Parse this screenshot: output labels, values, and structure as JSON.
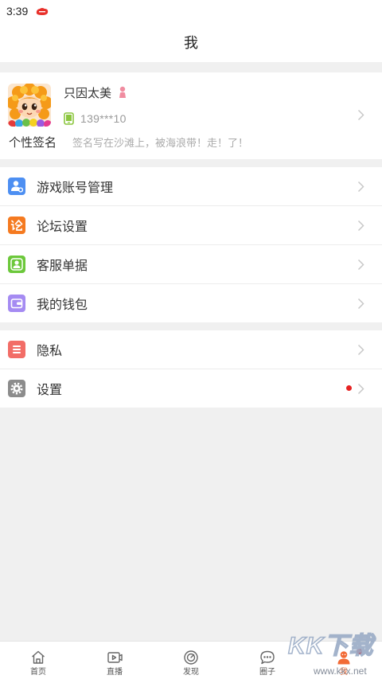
{
  "status_bar": {
    "time": "3:39",
    "notification_icon": "red-app-icon"
  },
  "header": {
    "title": "我"
  },
  "profile": {
    "avatar_icon": "sunflower-cartoon-avatar",
    "name": "只因太美",
    "gender_icon": "female-user-icon",
    "phone_icon": "phone-icon",
    "phone": "139***10",
    "signature_label": "个性签名",
    "signature": "签名写在沙滩上，被海浪带！走！了！"
  },
  "menu_groups": [
    {
      "items": [
        {
          "label": "游戏账号管理",
          "icon": "game-account-icon",
          "color": "#4d8ff2"
        },
        {
          "label": "论坛设置",
          "icon": "forum-settings-icon",
          "color": "#f57a20"
        },
        {
          "label": "客服单据",
          "icon": "customer-service-icon",
          "color": "#6cc83b"
        },
        {
          "label": "我的钱包",
          "icon": "wallet-icon",
          "color": "#a58bf2"
        }
      ]
    },
    {
      "items": [
        {
          "label": "隐私",
          "icon": "privacy-icon",
          "color": "#f26d67"
        },
        {
          "label": "设置",
          "icon": "settings-icon",
          "color": "#8c8c8c",
          "badge_dot": true
        }
      ]
    }
  ],
  "bottom_nav": {
    "active_color": "#f26a35",
    "items": [
      {
        "label": "首页",
        "icon": "home-icon"
      },
      {
        "label": "直播",
        "icon": "live-video-icon"
      },
      {
        "label": "发现",
        "icon": "discover-icon"
      },
      {
        "label": "圈子",
        "icon": "circle-chat-icon"
      },
      {
        "label": "我",
        "icon": "me-icon",
        "active": true,
        "badge_dot": true
      }
    ]
  },
  "watermark": {
    "brand": "KK下载",
    "site": "www.kkx.net"
  },
  "colors": {
    "badge_red": "#e62222",
    "page_background": "#f0f0f0"
  }
}
